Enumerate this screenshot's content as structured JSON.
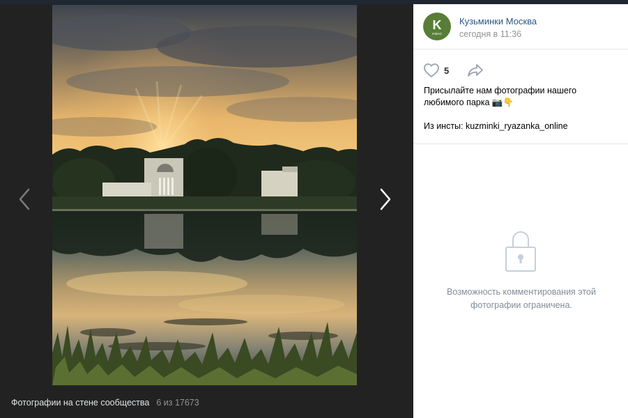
{
  "group": {
    "name": "Кузьминки Москва",
    "posted_time": "сегодня в 11:36",
    "avatar_letter": "K",
    "avatar_sub": "ЮВАО"
  },
  "actions": {
    "like_count": "5"
  },
  "caption": {
    "line1": "Присылайте нам фотографии нашего любимого парка 📷👇",
    "line2": "Из инсты: kuzminki_ryazanka_online"
  },
  "comments": {
    "closed_text": "Возможность комментирования этой фотографии ограничена."
  },
  "viewer": {
    "album_title": "Фотографии на стене сообщества",
    "counter": "6 из 17673"
  },
  "icons": {
    "like": "heart-outline-icon",
    "share": "share-arrow-icon",
    "lock": "lock-icon",
    "prev": "chevron-left-icon",
    "next": "chevron-right-icon"
  },
  "colors": {
    "link": "#2a5885",
    "muted": "#939393",
    "lock": "#c5d0db",
    "viewer_bg": "#222222"
  }
}
